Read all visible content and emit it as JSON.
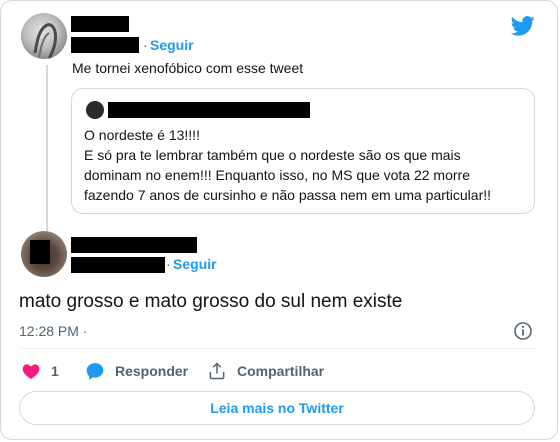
{
  "reply": {
    "follow_label": "Seguir",
    "text": "Me tornei xenofóbico com esse tweet"
  },
  "quoted": {
    "lines": [
      "O nordeste é 13!!!!",
      "E só pra te lembrar também que o nordeste são os que mais",
      "dominam no enem!!! Enquanto isso, no MS que vota 22 morre",
      "fazendo 7 anos de cursinho e não passa nem em uma particular!!"
    ]
  },
  "main": {
    "follow_label": "Seguir",
    "text": "mato grosso e mato grosso do sul nem existe",
    "time": "12:28 PM ·"
  },
  "actions": {
    "like_count": "1",
    "reply_label": "Responder",
    "share_label": "Compartilhar"
  },
  "read_more_label": "Leia mais no Twitter",
  "colors": {
    "accent": "#1d9bf0",
    "like": "#f91880",
    "border": "#cfd9de"
  }
}
